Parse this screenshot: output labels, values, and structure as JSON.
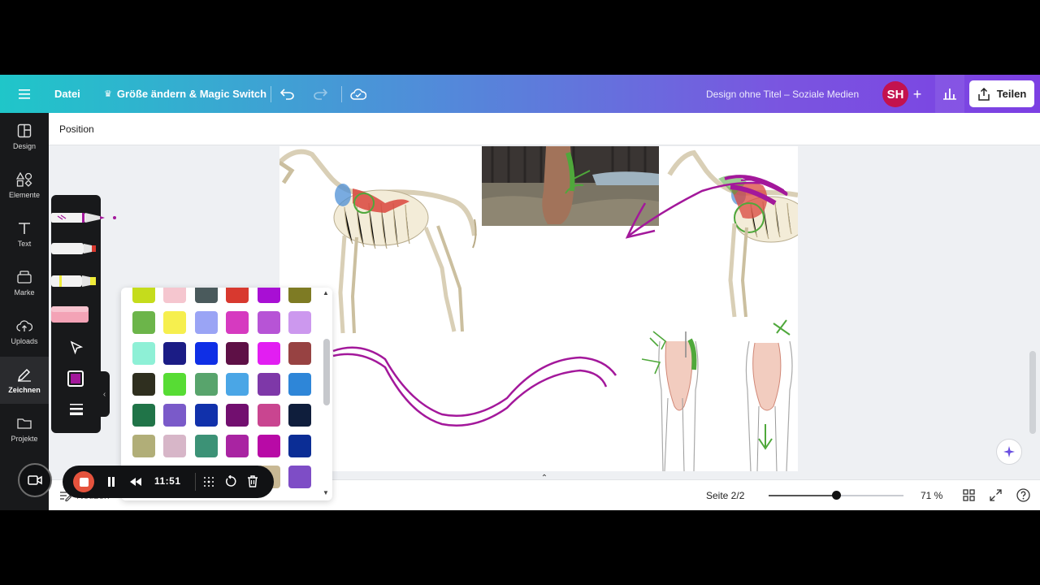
{
  "topbar": {
    "menu_icon": "hamburger-icon",
    "file_label": "Datei",
    "resize_label": "Größe ändern & Magic Switch",
    "design_title": "Design ohne Titel – Soziale Medien",
    "avatar_initials": "SH",
    "share_label": "Teilen"
  },
  "sidebar": {
    "items": [
      {
        "label": "Design",
        "icon": "design-icon"
      },
      {
        "label": "Elemente",
        "icon": "elements-icon"
      },
      {
        "label": "Text",
        "icon": "text-icon"
      },
      {
        "label": "Marke",
        "icon": "brand-icon"
      },
      {
        "label": "Uploads",
        "icon": "upload-icon"
      },
      {
        "label": "Zeichnen",
        "icon": "draw-icon"
      },
      {
        "label": "Projekte",
        "icon": "folder-icon"
      }
    ]
  },
  "context": {
    "position_label": "Position"
  },
  "bottombar": {
    "notes_label": "Notizen",
    "page_indicator": "Seite 2/2",
    "zoom_level": "71 %",
    "zoom_fraction": 0.5
  },
  "recorder": {
    "time": "11:51"
  },
  "palette": {
    "colors": [
      [
        "#c5dc1c",
        "#f5c6cf",
        "#4a5a5c",
        "#d8392f",
        "#a80fd4",
        "#7e7b24"
      ],
      [
        "#6cb54a",
        "#f6ef4e",
        "#9aa4f5",
        "#d63ac0",
        "#b754d6",
        "#cc98ee"
      ],
      [
        "#8ef0d6",
        "#1b1c85",
        "#0f2fe6",
        "#5e1046",
        "#e21ef2",
        "#974242"
      ],
      [
        "#2f2f1f",
        "#57dc34",
        "#58a46c",
        "#4aa6e6",
        "#7e38a8",
        "#2e86d8"
      ],
      [
        "#207448",
        "#7a5ac9",
        "#1131ab",
        "#720f6f",
        "#c94590",
        "#0f1e3c"
      ],
      [
        "#b1ae78",
        "#d7b6c8",
        "#3c9276",
        "#a924a2",
        "#b80aa6",
        "#0b2d95"
      ],
      [
        "#d7c2a0",
        "#c0a8a0",
        "#eab6d2",
        "#b2b2b2",
        "#c8b894",
        "#7e4dc6"
      ]
    ],
    "selected_color": "#a3189b"
  }
}
